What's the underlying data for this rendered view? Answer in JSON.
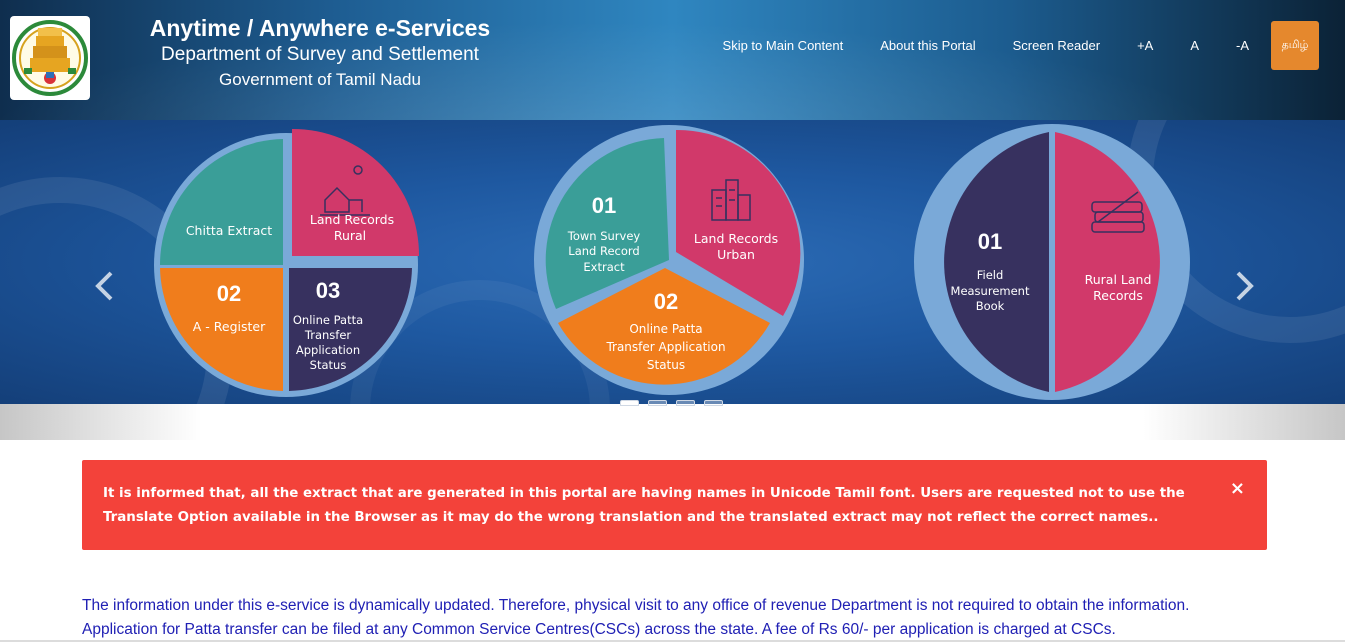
{
  "header": {
    "title": "Anytime / Anywhere e-Services",
    "subtitle": "Department of Survey and Settlement",
    "government": "Government of Tamil Nadu",
    "logo_icon": "tamil-nadu-emblem-icon",
    "nav": [
      {
        "label": "Skip to Main Content"
      },
      {
        "label": "About this Portal"
      },
      {
        "label": "Screen Reader"
      },
      {
        "label": "+A"
      },
      {
        "label": "A"
      },
      {
        "label": "-A"
      }
    ],
    "tamil_button": "தமிழ்"
  },
  "banner": {
    "prev_icon": "chevron-left-icon",
    "next_icon": "chevron-right-icon",
    "slide_count": 4,
    "active_slide": 1,
    "colors": {
      "teal": "#3a9e98",
      "pink": "#d1396a",
      "orange": "#f07d1c",
      "navy": "#37315f",
      "ring": "#7aa9d8"
    },
    "circle1": {
      "chitta": "Chitta Extract",
      "rural_line1": "Land Records",
      "rural_line2": "Rural",
      "num2": "02",
      "aregister": "A - Register",
      "num3": "03",
      "status_line1": "Online Patta",
      "status_line2": "Transfer",
      "status_line3": "Application",
      "status_line4": "Status"
    },
    "circle2": {
      "num1": "01",
      "town_line1": "Town Survey",
      "town_line2": "Land Record",
      "town_line3": "Extract",
      "urban_line1": "Land Records",
      "urban_line2": "Urban",
      "num2": "02",
      "status_line1": "Online Patta",
      "status_line2": "Transfer Application",
      "status_line3": "Status"
    },
    "circle3": {
      "num1": "01",
      "fmb_line1": "Field",
      "fmb_line2": "Measurement",
      "fmb_line3": "Book",
      "rural_line1": "Rural Land",
      "rural_line2": "Records"
    }
  },
  "alert": {
    "message": "It is informed that, all the extract that are generated in this portal are having names in Unicode Tamil font. Users are requested not to use the Translate Option available in the Browser as it may do the wrong translation and the translated extract may not reflect the correct names..",
    "close_label": "×",
    "color": "#f3423a"
  },
  "info": {
    "line1": "The information under this e-service is dynamically updated. Therefore, physical visit to any office of revenue Department is not required to obtain the information.",
    "line2": "Application for Patta transfer can be filed at any Common Service Centres(CSCs) across the state. A fee of Rs 60/- per application is charged at CSCs."
  }
}
